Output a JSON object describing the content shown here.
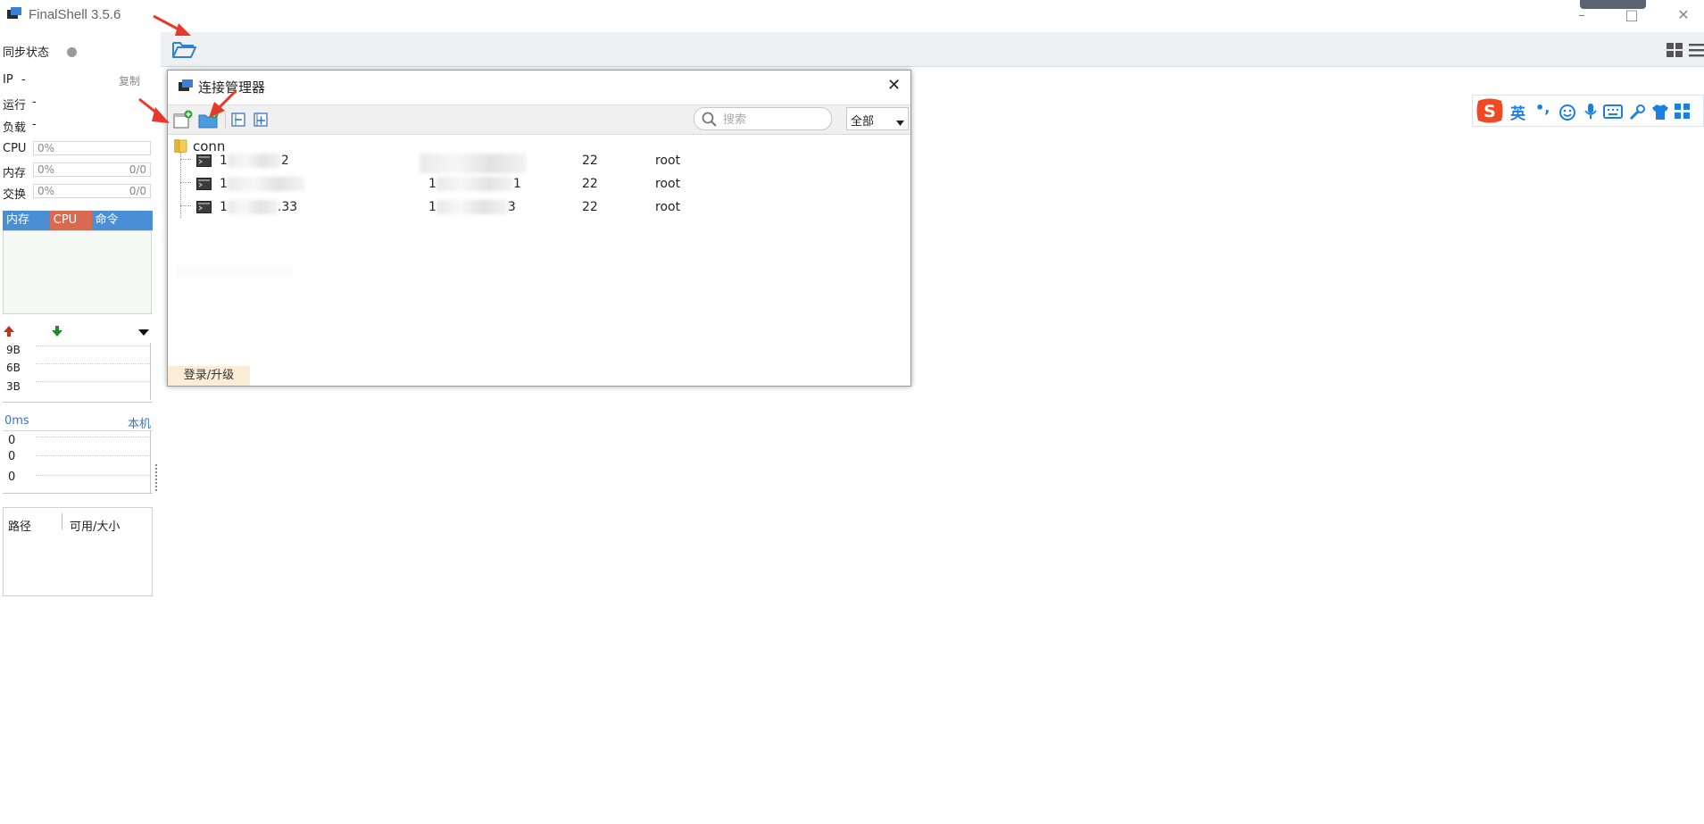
{
  "window": {
    "title": "FinalShell 3.5.6",
    "minimize_glyph": "–",
    "maximize_glyph": "□",
    "close_glyph": "✕"
  },
  "status_panel": {
    "sync_label": "同步状态",
    "ip_label": "IP",
    "ip_value": "-",
    "copy_label": "复制",
    "uptime_label": "运行",
    "uptime_value": "-",
    "load_label": "负载",
    "load_value": "-",
    "cpu_label": "CPU",
    "cpu_value": "0%",
    "mem_label": "内存",
    "mem_value": "0%",
    "mem_total": "0/0",
    "swap_label": "交换",
    "swap_value": "0%",
    "swap_total": "0/0",
    "tabs": [
      {
        "label": "内存",
        "color": "#4a8fd6"
      },
      {
        "label": "CPU",
        "color": "#d9694f"
      },
      {
        "label": "命令",
        "color": "#4a8fd6"
      }
    ],
    "net_ticks": [
      "9B",
      "6B",
      "3B"
    ],
    "ping_label": "0ms",
    "ping_target": "本机",
    "ping_values": [
      "0",
      "0",
      "0"
    ],
    "disk_cols": [
      "路径",
      "可用/大小"
    ]
  },
  "dialog": {
    "title": "连接管理器",
    "close_glyph": "✕",
    "search_placeholder": "搜索",
    "filter_value": "全部",
    "folder_name": "conn",
    "connections": [
      {
        "name_head": "1",
        "name_tail": "2",
        "host_head": "",
        "host_tail": "",
        "port": "22",
        "user": "root"
      },
      {
        "name_head": "1",
        "name_tail": "",
        "host_head": "1",
        "host_tail": "1",
        "port": "22",
        "user": "root"
      },
      {
        "name_head": "1",
        "name_tail": ".33",
        "host_head": "1",
        "host_tail": "3",
        "port": "22",
        "user": "root"
      }
    ],
    "login_upgrade_label": "登录/升级"
  },
  "ime_bar": {
    "logo_glyph": "S",
    "lang_label": "英",
    "punct_glyph": "•,"
  },
  "colors": {
    "accent_blue": "#4a8fd6",
    "cpu_tab": "#d9694f",
    "arrow_red": "#e8382a",
    "ime_blue": "#1b7fe0",
    "ime_logo": "#f04a24"
  }
}
